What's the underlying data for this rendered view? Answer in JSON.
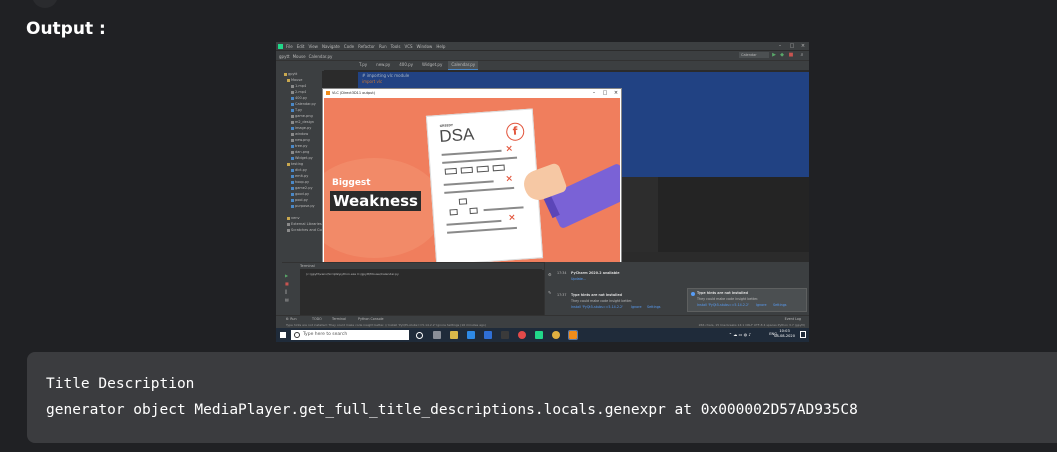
{
  "output_label": "Output :",
  "ide": {
    "menu": [
      "File",
      "Edit",
      "View",
      "Navigate",
      "Code",
      "Refactor",
      "Run",
      "Tools",
      "VCS",
      "Window",
      "Help"
    ],
    "breadcrumb": [
      "gpytt",
      "Mouse",
      "Calendar.py"
    ],
    "run_config": "Calendar",
    "editor_tabs": [
      "T.py",
      "new.py",
      "400.py",
      "Widget.py",
      "Calendar.py"
    ],
    "active_tab_index": 4,
    "project_root": "gpytt",
    "tree_items": [
      "Mouse",
      "1.mp4",
      "2.mp4",
      "400.py",
      "Calendar.py",
      "T.py",
      "game.png",
      "m2_design",
      "image.py",
      "window",
      "new.png",
      "tree.py",
      "dan.png",
      "Widget.py",
      "testing",
      "dict.py",
      "emit.py",
      "hoop.py",
      "game2.py",
      "good.py",
      "pool.py",
      "purpose.py",
      "venv",
      "External Libraries",
      "Scratches and Con"
    ],
    "code_lines": [
      "# importing vlc module",
      "import vlc"
    ],
    "terminal_tab": "Terminal",
    "terminal_line": "(c:\\gpytt\\venv\\Scripts\\python.exe C:/gpytt/Mouse/Calendar.py",
    "event_log_title": "Event Log",
    "event1_time": "17:34",
    "event1_title": "PyCharm 2020.2 available",
    "event1_link": "Update...",
    "event2_time": "17:37",
    "event2_title": "Type hints are not installed",
    "event2_body": "They could make code insight better.",
    "event2_links": [
      "Install 'PyQt5-stubs==5.14.2.2'",
      "Ignore",
      "Settings"
    ],
    "notif_title": "Type hints are not installed",
    "notif_body": "They could make code insight better.",
    "notif_links": [
      "Install 'PyQt5-stubs==5.14.2.2'",
      "Ignore",
      "Settings"
    ],
    "bottom_tools": [
      "6: Run",
      "TODO",
      "Terminal",
      "Python Console"
    ],
    "event_log_btn": "Event Log",
    "status_left": "Type hints are not installed: They could make code insight better. // Install 'PyQt5-stubs==5.14.2.2'  Ignore  Settings (16 minutes ago)",
    "status_right": "266 chars, 15 line breaks   14:1   CRLF   UTF-8   4 spaces   Python 3.7 (gpytt)"
  },
  "vlc": {
    "title": "VLC (Direct3D11 output)",
    "headline_small": "Biggest",
    "headline_big": "Weakness",
    "paper_header": "GREEDY",
    "paper_title": "DSA",
    "paper_logo": "f"
  },
  "taskbar": {
    "search_placeholder": "Type here to search",
    "lang": "ENG",
    "time": "10:03",
    "date": "08-08-2020"
  },
  "result": {
    "line1": "Title Description",
    "line2": "generator object MediaPlayer.get_full_title_descriptions.locals.genexpr at 0x000002D57AD935C8"
  }
}
